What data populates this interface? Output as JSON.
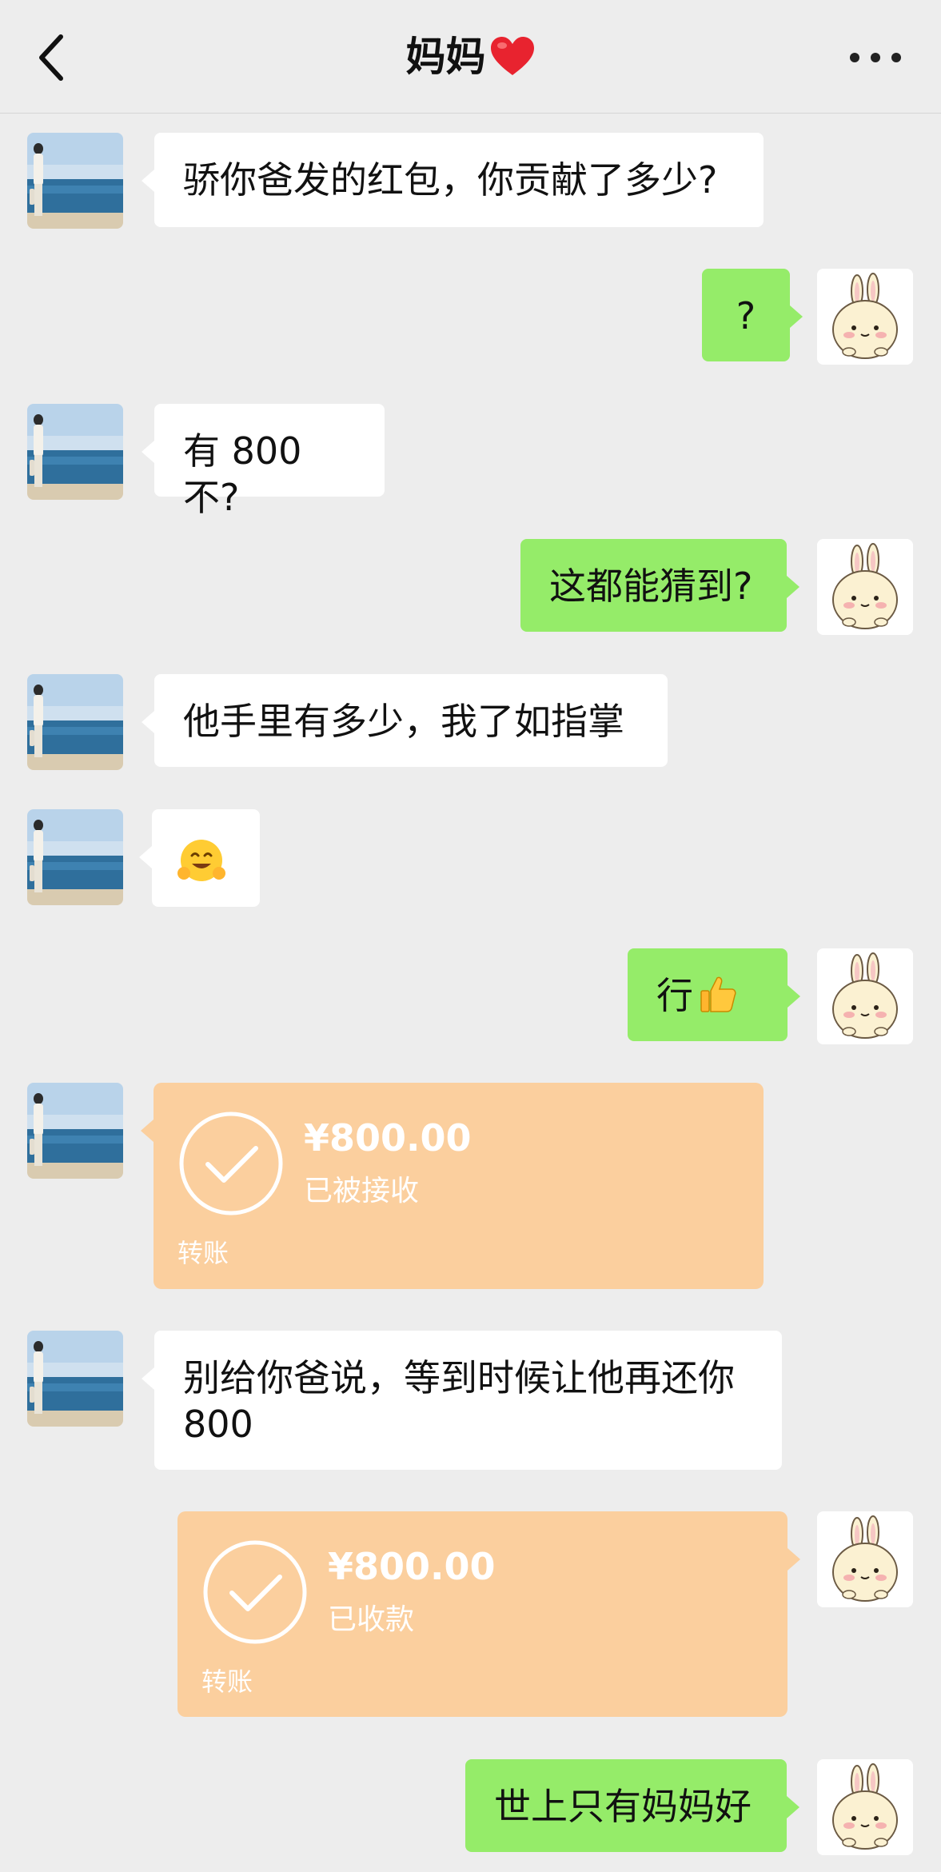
{
  "header": {
    "title": "妈妈",
    "back_icon": "chevron-left-icon",
    "title_icon": "red-heart-icon",
    "more_icon": "more-horizontal-icon"
  },
  "messages": [
    {
      "side": "left",
      "type": "text",
      "text": "骄你爸发的红包，你贡献了多少?"
    },
    {
      "side": "right",
      "type": "text",
      "text": "?"
    },
    {
      "side": "left",
      "type": "text",
      "text": "有 800 不?"
    },
    {
      "side": "right",
      "type": "text",
      "text": "这都能猜到?"
    },
    {
      "side": "left",
      "type": "text",
      "text": "他手里有多少，我了如指掌"
    },
    {
      "side": "left",
      "type": "emoji",
      "icon": "smiling-hug-emoji-icon"
    },
    {
      "side": "right",
      "type": "text",
      "text": "行",
      "icon": "thumbs-up-emoji-icon"
    },
    {
      "side": "left",
      "type": "transfer",
      "amount": "¥800.00",
      "status": "已被接收",
      "label": "转账"
    },
    {
      "side": "left",
      "type": "text",
      "text_line1": "别给你爸说，等到时候让他再还你",
      "text_line2": "800"
    },
    {
      "side": "right",
      "type": "transfer",
      "amount": "¥800.00",
      "status": "已收款",
      "label": "转账"
    },
    {
      "side": "right",
      "type": "text",
      "text": "世上只有妈妈好"
    }
  ],
  "colors": {
    "background": "#ededed",
    "bubble_self": "#95ec69",
    "bubble_other": "#ffffff",
    "transfer_card": "#fbcf9e",
    "heart": "#e8232f"
  }
}
